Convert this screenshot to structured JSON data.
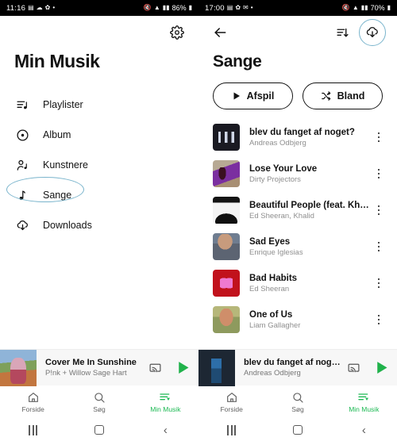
{
  "left_screen": {
    "statusbar": {
      "time": "11:16",
      "icons": [
        "image-icon",
        "cloud-icon",
        "gear-icon",
        "dot-icon"
      ],
      "right_icons": [
        "mute-icon",
        "wifi-icon",
        "signal-icon"
      ],
      "battery": "86%"
    },
    "appbar": {
      "settings_icon": "gear-icon"
    },
    "title": "Min Musik",
    "nav": [
      {
        "label": "Playlister",
        "icon": "playlist-icon",
        "selected": false
      },
      {
        "label": "Album",
        "icon": "disc-icon",
        "selected": false
      },
      {
        "label": "Kunstnere",
        "icon": "artist-icon",
        "selected": false
      },
      {
        "label": "Sange",
        "icon": "note-icon",
        "selected": true
      },
      {
        "label": "Downloads",
        "icon": "download-cloud-icon",
        "selected": false
      }
    ],
    "miniplayer": {
      "title": "Cover Me In Sunshine",
      "artist": "P!nk + Willow Sage Hart",
      "cast_icon": "cast-icon",
      "play_icon": "play-icon",
      "art": "artpink"
    },
    "bottomnav": [
      {
        "label": "Forside",
        "icon": "home-icon",
        "active": false
      },
      {
        "label": "Søg",
        "icon": "search-icon",
        "active": false
      },
      {
        "label": "Min Musik",
        "icon": "library-icon",
        "active": true
      }
    ],
    "sysnav": [
      "recents-button",
      "home-button",
      "back-button"
    ]
  },
  "right_screen": {
    "statusbar": {
      "time": "17:00",
      "icons": [
        "sim-icon",
        "gear-icon",
        "mail-icon",
        "dot-icon"
      ],
      "right_icons": [
        "mute-icon",
        "wifi-icon",
        "signal-icon"
      ],
      "battery": "70%"
    },
    "appbar": {
      "back_icon": "back-arrow-icon",
      "sort_icon": "sort-icon",
      "download_icon": "download-cloud-icon"
    },
    "title": "Sange",
    "actions": [
      {
        "label": "Afspil",
        "icon": "play-icon"
      },
      {
        "label": "Bland",
        "icon": "shuffle-icon"
      }
    ],
    "songs": [
      {
        "title": "blev du fanget af noget?",
        "artist": "Andreas Odbjerg",
        "art": "art1"
      },
      {
        "title": "Lose Your Love",
        "artist": "Dirty Projectors",
        "art": "art2"
      },
      {
        "title": "Beautiful People (feat. Khalid)",
        "artist": "Ed Sheeran, Khalid",
        "art": "art3"
      },
      {
        "title": "Sad Eyes",
        "artist": "Enrique Iglesias",
        "art": "art4"
      },
      {
        "title": "Bad Habits",
        "artist": "Ed Sheeran",
        "art": "art5"
      },
      {
        "title": "One of Us",
        "artist": "Liam Gallagher",
        "art": "art6"
      }
    ],
    "miniplayer": {
      "title": "blev du fanget af noget?",
      "artist": "Andreas Odbjerg",
      "cast_icon": "cast-icon",
      "play_icon": "play-icon",
      "art": "artblue"
    },
    "bottomnav": [
      {
        "label": "Forside",
        "icon": "home-icon",
        "active": false
      },
      {
        "label": "Søg",
        "icon": "search-icon",
        "active": false
      },
      {
        "label": "Min Musik",
        "icon": "library-icon",
        "active": true
      }
    ],
    "sysnav": [
      "recents-button",
      "home-button",
      "back-button"
    ]
  },
  "annotations": {
    "accent_color": "#79b4cc",
    "targets": [
      "sange-nav-item",
      "download-icon"
    ]
  },
  "colors": {
    "accent_green": "#1db954",
    "text_primary": "#121212",
    "text_secondary": "#8f8f8f"
  }
}
